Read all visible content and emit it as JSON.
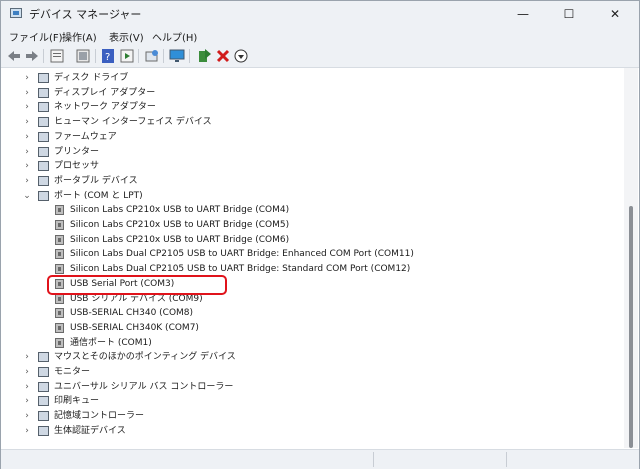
{
  "window": {
    "title": "デバイス マネージャー",
    "minimize": "—",
    "maximize": "☐",
    "close": "✕"
  },
  "menu": [
    {
      "label": "ファイル(F)"
    },
    {
      "label": "操作(A)"
    },
    {
      "label": "表示(V)"
    },
    {
      "label": "ヘルプ(H)"
    }
  ],
  "toolbar": {
    "buttons": [
      "back-arrow-icon",
      "forward-arrow-icon",
      "properties-icon",
      "view-icon",
      "help-icon",
      "list-icon",
      "scan-hardware-icon",
      "monitor-icon",
      "add-driver-icon",
      "uninstall-icon",
      "download-icon"
    ]
  },
  "tree": {
    "categories_top": [
      {
        "label": "ディスク ドライブ",
        "icon": "disk-drive-icon"
      },
      {
        "label": "ディスプレイ アダプター",
        "icon": "display-adapter-icon"
      },
      {
        "label": "ネットワーク アダプター",
        "icon": "network-adapter-icon"
      },
      {
        "label": "ヒューマン インターフェイス デバイス",
        "icon": "hid-icon"
      },
      {
        "label": "ファームウェア",
        "icon": "firmware-icon"
      },
      {
        "label": "プリンター",
        "icon": "printer-icon"
      },
      {
        "label": "プロセッサ",
        "icon": "processor-icon"
      },
      {
        "label": "ポータブル デバイス",
        "icon": "portable-device-icon"
      }
    ],
    "ports": {
      "label": "ポート (COM と LPT)",
      "children": [
        {
          "label": "Silicon Labs CP210x USB to UART Bridge (COM4)"
        },
        {
          "label": "Silicon Labs CP210x USB to UART Bridge (COM5)"
        },
        {
          "label": "Silicon Labs CP210x USB to UART Bridge (COM6)"
        },
        {
          "label": "Silicon Labs Dual CP2105 USB to UART Bridge: Enhanced COM Port (COM11)"
        },
        {
          "label": "Silicon Labs Dual CP2105 USB to UART Bridge: Standard COM Port (COM12)"
        },
        {
          "label": "USB Serial Port (COM3)"
        },
        {
          "label": "USB シリアル デバイス (COM9)"
        },
        {
          "label": "USB-SERIAL CH340 (COM8)"
        },
        {
          "label": "USB-SERIAL CH340K (COM7)"
        },
        {
          "label": "通信ポート (COM1)"
        }
      ]
    },
    "categories_bottom": [
      {
        "label": "マウスとそのほかのポインティング デバイス",
        "icon": "mouse-icon"
      },
      {
        "label": "モニター",
        "icon": "monitor-icon"
      },
      {
        "label": "ユニバーサル シリアル バス コントローラー",
        "icon": "usb-controller-icon"
      },
      {
        "label": "印刷キュー",
        "icon": "print-queue-icon"
      },
      {
        "label": "記憶域コントローラー",
        "icon": "storage-controller-icon"
      },
      {
        "label": "生体認証デバイス",
        "icon": "biometric-icon"
      }
    ]
  },
  "colors": {
    "highlight": "#e0131b",
    "chrome": "#eef1f5"
  }
}
